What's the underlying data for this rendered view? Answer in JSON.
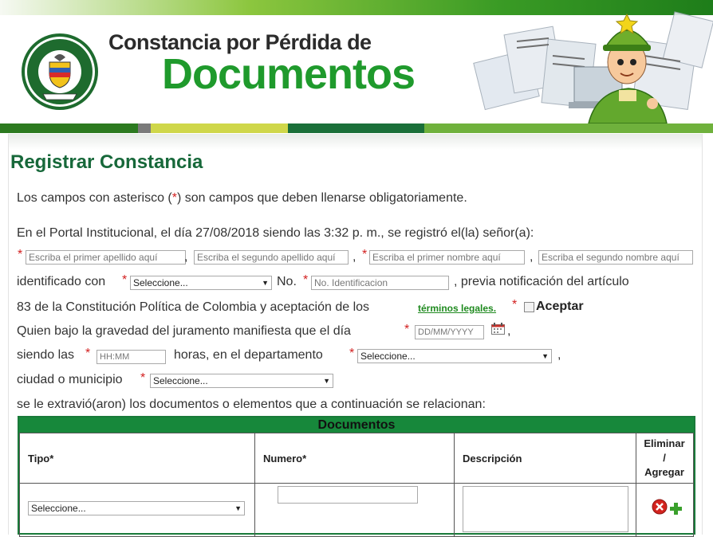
{
  "banner": {
    "title_line1": "Constancia por Pérdida de",
    "title_line2": "Documentos",
    "seal_text_top": "REPUBLICA DE COLOMBIA",
    "seal_text_bottom": "POLICIA NACIONAL",
    "seal_motto": "DIOS Y PATRIA"
  },
  "page": {
    "title": "Registrar Constancia",
    "intro_a": "Los campos con asterisco (",
    "intro_star": "*",
    "intro_b": ") son campos que deben llenarse obligatoriamente.",
    "portal_text": "En el Portal Institucional, el día 27/08/2018 siendo las 3:32 p. m., se registró el(la) señor(a):"
  },
  "form": {
    "asterisk": "*",
    "comma": ",",
    "apellido1_placeholder": "Escriba el primer apellido aquí",
    "apellido2_placeholder": "Escriba el segundo apellido aquí",
    "nombre1_placeholder": "Escriba el primer nombre aquí",
    "nombre2_placeholder": "Escriba el segundo nombre aquí",
    "identificado_label": "identificado con",
    "tipo_doc_value": "Seleccione...",
    "no_label": "No.",
    "no_id_placeholder": "No. Identificacion",
    "previa_text": ", previa notificación del artículo",
    "art83_text": "83 de la Constitución Política de Colombia y aceptación de los",
    "terminos_link": "términos legales.",
    "aceptar_label": "Aceptar",
    "juramento_text": "Quien bajo la gravedad del juramento manifiesta que el día",
    "fecha_placeholder": "DD/MM/YYYY",
    "siendo_label": "siendo las",
    "hora_placeholder": "HH:MM",
    "horas_text": "horas, en el departamento",
    "departamento_value": "Seleccione...",
    "ciudad_label": "ciudad o municipio",
    "ciudad_value": "Seleccione...",
    "extravio_text": "se le extravió(aron) los documentos o elementos que a continuación se relacionan:"
  },
  "documents": {
    "header": "Documentos",
    "columns": [
      "Tipo*",
      "Numero*",
      "Descripción",
      "Eliminar",
      "/",
      "Agregar"
    ],
    "row_tipo_value": "Seleccione..."
  },
  "colors": {
    "title_green": "#17683a",
    "brand_green": "#1f9a2c",
    "required_red": "#d21f1f",
    "table_header_green": "#17883b"
  },
  "icons": [
    "calendar-icon",
    "delete-icon",
    "add-icon"
  ]
}
